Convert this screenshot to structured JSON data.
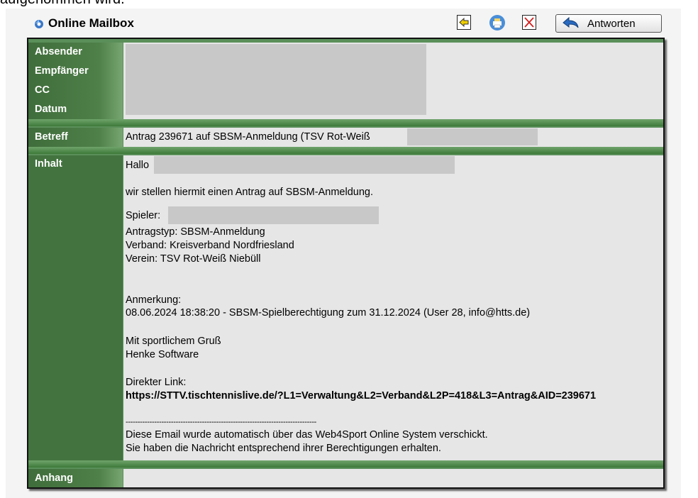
{
  "page_fragment": "aufgenommen wird.",
  "window": {
    "title": "Online Mailbox"
  },
  "toolbar": {
    "reply_label": "Antworten"
  },
  "labels": {
    "absender": "Absender",
    "empfaenger": "Empfänger",
    "cc": "CC",
    "datum": "Datum",
    "betreff": "Betreff",
    "inhalt": "Inhalt",
    "anhang": "Anhang"
  },
  "message": {
    "subject": "Antrag 239671 auf SBSM-Anmeldung (TSV Rot-Weiß",
    "greeting": "Hallo",
    "intro": "wir stellen hiermit einen Antrag auf SBSM-Anmeldung.",
    "spieler_label": "Spieler:",
    "antragstyp": "Antragstyp: SBSM-Anmeldung",
    "verband": "Verband: Kreisverband Nordfriesland",
    "verein": "Verein: TSV Rot-Weiß Niebüll",
    "anmerkung_label": "Anmerkung:",
    "anmerkung": "08.06.2024 18:38:20 - SBSM-Spielberechtigung zum 31.12.2024 (User 28, info@htts.de)",
    "closing": "Mit sportlichem Gruß",
    "sender": "Henke Software",
    "link_label": "Direkter Link:",
    "link": "https://STTV.tischtennislive.de/?L1=Verwaltung&L2=Verband&L2P=418&L3=Antrag&AID=239671",
    "divider": "--------------------------------------------------------------------------------",
    "footer1": "Diese Email wurde automatisch über das Web4Sport Online System verschickt.",
    "footer2": "Sie haben die Nachricht entsprechend ihrer Berechtigungen erhalten."
  },
  "colors": {
    "label_green": "#43743f",
    "separator_green": "#5a8f5a",
    "cell_gray": "#e6e6e6",
    "redacted": "#c8c8c8"
  },
  "icons": [
    "mailbox-icon",
    "back-arrow-icon",
    "print-icon",
    "delete-icon",
    "reply-icon"
  ]
}
